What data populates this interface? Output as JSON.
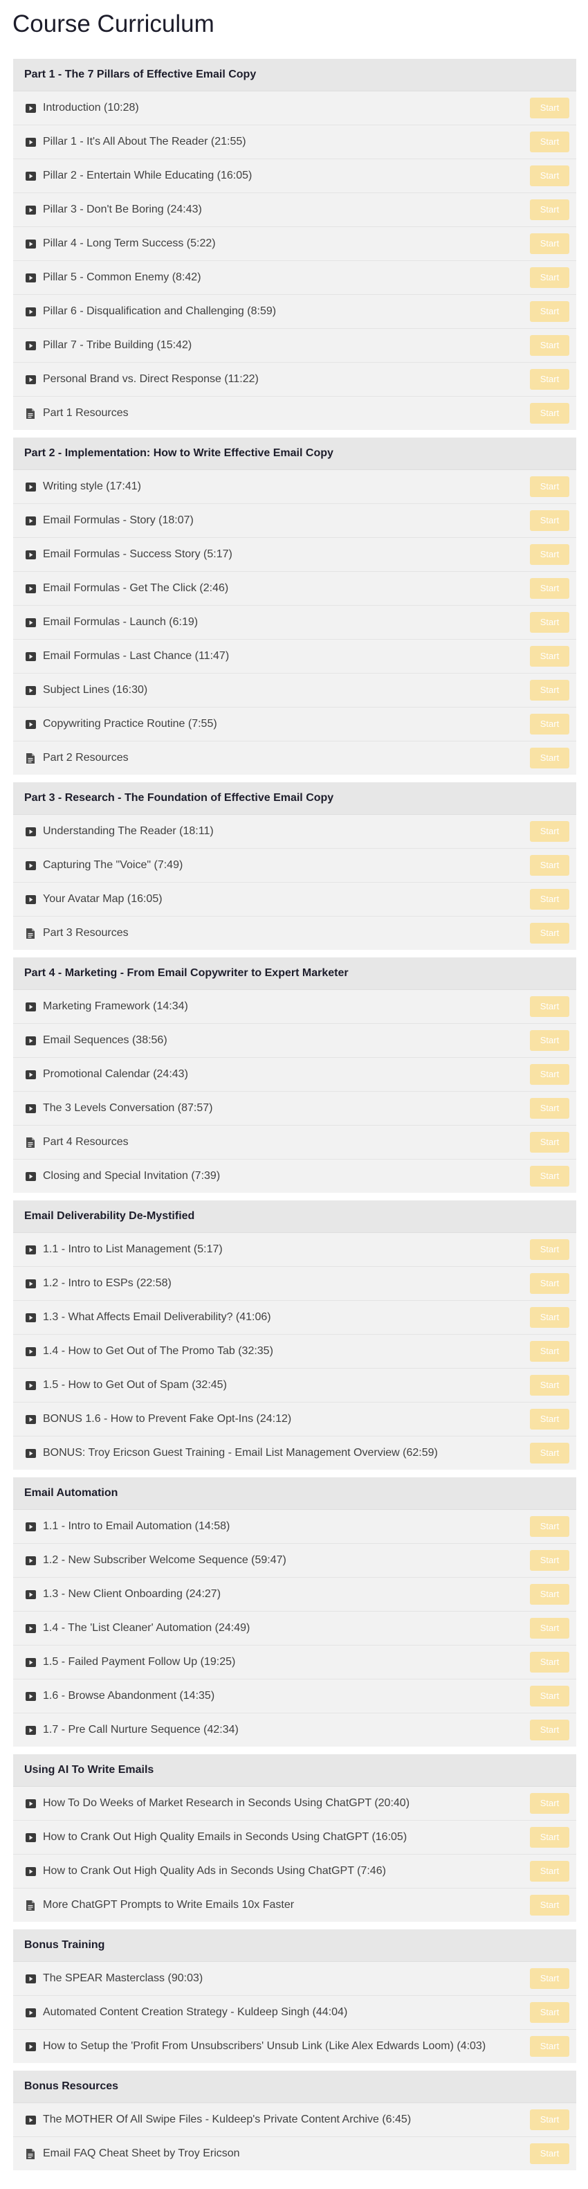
{
  "page": {
    "title": "Course Curriculum"
  },
  "sections": [
    {
      "title": "Part 1 - The 7 Pillars of Effective Email Copy",
      "lectures": [
        {
          "title": "Introduction (10:28)",
          "icon": "play-video-icon",
          "button": "Start"
        },
        {
          "title": "Pillar 1 - It's All About The Reader (21:55)",
          "icon": "play-video-icon",
          "button": "Start"
        },
        {
          "title": "Pillar 2 - Entertain While Educating (16:05)",
          "icon": "play-video-icon",
          "button": "Start"
        },
        {
          "title": "Pillar 3 - Don't Be Boring (24:43)",
          "icon": "play-video-icon",
          "button": "Start"
        },
        {
          "title": "Pillar 4 - Long Term Success (5:22)",
          "icon": "play-video-icon",
          "button": "Start"
        },
        {
          "title": "Pillar 5 - Common Enemy (8:42)",
          "icon": "play-video-icon",
          "button": "Start"
        },
        {
          "title": "Pillar 6 - Disqualification and Challenging (8:59)",
          "icon": "play-video-icon",
          "button": "Start"
        },
        {
          "title": "Pillar 7 - Tribe Building (15:42)",
          "icon": "play-video-icon",
          "button": "Start"
        },
        {
          "title": "Personal Brand vs. Direct Response (11:22)",
          "icon": "play-video-icon",
          "button": "Start"
        },
        {
          "title": "Part 1 Resources",
          "icon": "document-icon",
          "button": "Start"
        }
      ]
    },
    {
      "title": "Part 2 - Implementation: How to Write Effective Email Copy",
      "lectures": [
        {
          "title": "Writing style (17:41)",
          "icon": "play-video-icon",
          "button": "Start"
        },
        {
          "title": "Email Formulas - Story (18:07)",
          "icon": "play-video-icon",
          "button": "Start"
        },
        {
          "title": "Email Formulas - Success Story (5:17)",
          "icon": "play-video-icon",
          "button": "Start"
        },
        {
          "title": "Email Formulas - Get The Click (2:46)",
          "icon": "play-video-icon",
          "button": "Start"
        },
        {
          "title": "Email Formulas - Launch (6:19)",
          "icon": "play-video-icon",
          "button": "Start"
        },
        {
          "title": "Email Formulas - Last Chance (11:47)",
          "icon": "play-video-icon",
          "button": "Start"
        },
        {
          "title": "Subject Lines (16:30)",
          "icon": "play-video-icon",
          "button": "Start"
        },
        {
          "title": "Copywriting Practice Routine (7:55)",
          "icon": "play-video-icon",
          "button": "Start"
        },
        {
          "title": "Part 2 Resources",
          "icon": "document-icon",
          "button": "Start"
        }
      ]
    },
    {
      "title": "Part 3 - Research - The Foundation of Effective Email Copy",
      "lectures": [
        {
          "title": "Understanding The Reader (18:11)",
          "icon": "play-video-icon",
          "button": "Start"
        },
        {
          "title": "Capturing The \"Voice\" (7:49)",
          "icon": "play-video-icon",
          "button": "Start"
        },
        {
          "title": "Your Avatar Map (16:05)",
          "icon": "play-video-icon",
          "button": "Start"
        },
        {
          "title": "Part 3 Resources",
          "icon": "document-icon",
          "button": "Start"
        }
      ]
    },
    {
      "title": "Part 4 - Marketing - From Email Copywriter to Expert Marketer",
      "lectures": [
        {
          "title": "Marketing Framework (14:34)",
          "icon": "play-video-icon",
          "button": "Start"
        },
        {
          "title": "Email Sequences (38:56)",
          "icon": "play-video-icon",
          "button": "Start"
        },
        {
          "title": "Promotional Calendar (24:43)",
          "icon": "play-video-icon",
          "button": "Start"
        },
        {
          "title": "The 3 Levels Conversation (87:57)",
          "icon": "play-video-icon",
          "button": "Start"
        },
        {
          "title": "Part 4 Resources",
          "icon": "document-icon",
          "button": "Start"
        },
        {
          "title": "Closing and Special Invitation (7:39)",
          "icon": "play-video-icon",
          "button": "Start"
        }
      ]
    },
    {
      "title": "Email Deliverability De-Mystified",
      "lectures": [
        {
          "title": "1.1 - Intro to List Management (5:17)",
          "icon": "play-video-icon",
          "button": "Start"
        },
        {
          "title": "1.2 - Intro to ESPs (22:58)",
          "icon": "play-video-icon",
          "button": "Start"
        },
        {
          "title": "1.3 - What Affects Email Deliverability? (41:06)",
          "icon": "play-video-icon",
          "button": "Start"
        },
        {
          "title": "1.4 - How to Get Out of The Promo Tab (32:35)",
          "icon": "play-video-icon",
          "button": "Start"
        },
        {
          "title": "1.5 - How to Get Out of Spam (32:45)",
          "icon": "play-video-icon",
          "button": "Start"
        },
        {
          "title": "BONUS 1.6 - How to Prevent Fake Opt-Ins (24:12)",
          "icon": "play-video-icon",
          "button": "Start"
        },
        {
          "title": "BONUS: Troy Ericson Guest Training - Email List Management Overview (62:59)",
          "icon": "play-video-icon",
          "button": "Start"
        }
      ]
    },
    {
      "title": "Email Automation",
      "lectures": [
        {
          "title": "1.1 - Intro to Email Automation (14:58)",
          "icon": "play-video-icon",
          "button": "Start"
        },
        {
          "title": "1.2 - New Subscriber Welcome Sequence (59:47)",
          "icon": "play-video-icon",
          "button": "Start"
        },
        {
          "title": "1.3 - New Client Onboarding (24:27)",
          "icon": "play-video-icon",
          "button": "Start"
        },
        {
          "title": "1.4 - The 'List Cleaner' Automation (24:49)",
          "icon": "play-video-icon",
          "button": "Start"
        },
        {
          "title": "1.5 - Failed Payment Follow Up (19:25)",
          "icon": "play-video-icon",
          "button": "Start"
        },
        {
          "title": "1.6 - Browse Abandonment (14:35)",
          "icon": "play-video-icon",
          "button": "Start"
        },
        {
          "title": "1.7 - Pre Call Nurture Sequence (42:34)",
          "icon": "play-video-icon",
          "button": "Start"
        }
      ]
    },
    {
      "title": "Using AI To Write Emails",
      "lectures": [
        {
          "title": "How To Do Weeks of Market Research in Seconds Using ChatGPT (20:40)",
          "icon": "play-video-icon",
          "button": "Start"
        },
        {
          "title": "How to Crank Out High Quality Emails in Seconds Using ChatGPT (16:05)",
          "icon": "play-video-icon",
          "button": "Start"
        },
        {
          "title": "How to Crank Out High Quality Ads in Seconds Using ChatGPT (7:46)",
          "icon": "play-video-icon",
          "button": "Start"
        },
        {
          "title": "More ChatGPT Prompts to Write Emails 10x Faster",
          "icon": "document-icon",
          "button": "Start"
        }
      ]
    },
    {
      "title": "Bonus Training",
      "lectures": [
        {
          "title": "The SPEAR Masterclass (90:03)",
          "icon": "play-video-icon",
          "button": "Start"
        },
        {
          "title": "Automated Content Creation Strategy - Kuldeep Singh (44:04)",
          "icon": "play-video-icon",
          "button": "Start"
        },
        {
          "title": "How to Setup the 'Profit From Unsubscribers' Unsub Link (Like Alex Edwards Loom) (4:03)",
          "icon": "play-video-icon",
          "button": "Start"
        }
      ]
    },
    {
      "title": "Bonus Resources",
      "lectures": [
        {
          "title": "The MOTHER Of All Swipe Files - Kuldeep's Private Content Archive (6:45)",
          "icon": "play-video-icon",
          "button": "Start"
        },
        {
          "title": "Email FAQ Cheat Sheet by Troy Ericson",
          "icon": "document-icon",
          "button": "Start"
        }
      ]
    }
  ],
  "colors": {
    "start_button_bg": "#f9e2a4",
    "section_header_bg": "#e7e7e7",
    "lecture_bg": "#f2f2f2"
  }
}
